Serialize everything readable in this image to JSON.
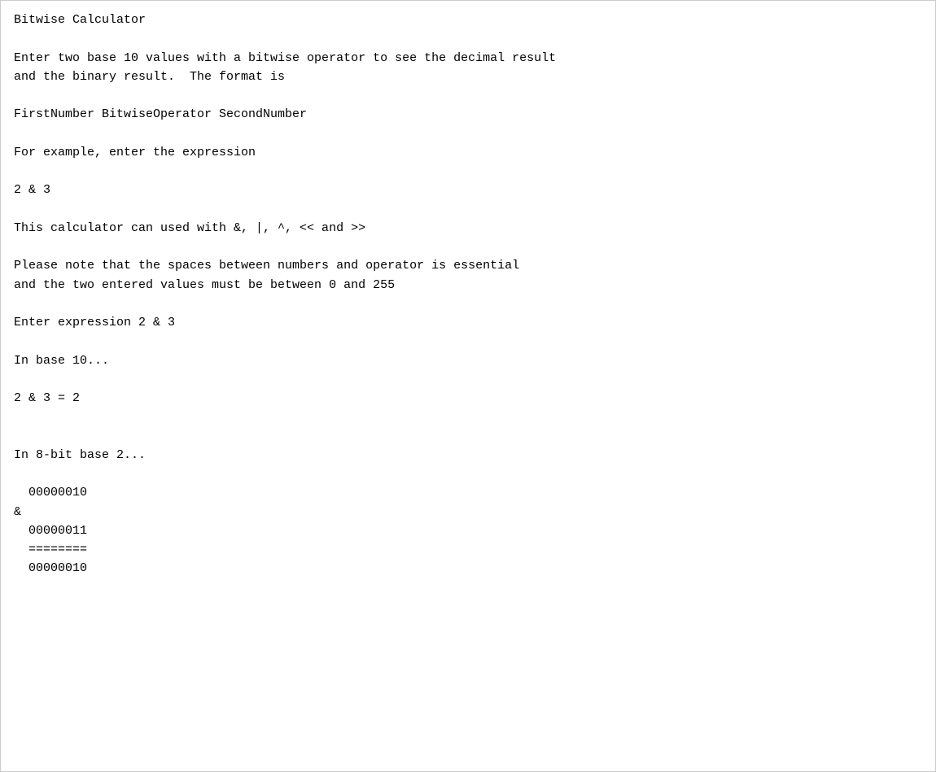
{
  "title": "Bitwise Calculator",
  "lines": [
    {
      "id": "title",
      "text": "Bitwise Calculator"
    },
    {
      "id": "blank1",
      "text": ""
    },
    {
      "id": "intro1",
      "text": "Enter two base 10 values with a bitwise operator to see the decimal result"
    },
    {
      "id": "intro2",
      "text": "and the binary result.  The format is"
    },
    {
      "id": "blank2",
      "text": ""
    },
    {
      "id": "format",
      "text": "FirstNumber BitwiseOperator SecondNumber"
    },
    {
      "id": "blank3",
      "text": ""
    },
    {
      "id": "example_label",
      "text": "For example, enter the expression"
    },
    {
      "id": "blank4",
      "text": ""
    },
    {
      "id": "example_expr",
      "text": "2 & 3"
    },
    {
      "id": "blank5",
      "text": ""
    },
    {
      "id": "operators",
      "text": "This calculator can used with &, |, ^, << and >>"
    },
    {
      "id": "blank6",
      "text": ""
    },
    {
      "id": "note1",
      "text": "Please note that the spaces between numbers and operator is essential"
    },
    {
      "id": "note2",
      "text": "and the two entered values must be between 0 and 255"
    },
    {
      "id": "blank7",
      "text": ""
    },
    {
      "id": "input_line",
      "text": "Enter expression 2 & 3"
    },
    {
      "id": "blank8",
      "text": ""
    },
    {
      "id": "base10_label",
      "text": "In base 10..."
    },
    {
      "id": "blank9",
      "text": ""
    },
    {
      "id": "base10_result",
      "text": "2 & 3 = 2"
    },
    {
      "id": "blank10",
      "text": ""
    },
    {
      "id": "blank11",
      "text": ""
    },
    {
      "id": "base2_label",
      "text": "In 8-bit base 2..."
    },
    {
      "id": "blank12",
      "text": ""
    },
    {
      "id": "binary_num1",
      "text": "  00000010"
    },
    {
      "id": "binary_op",
      "text": "&"
    },
    {
      "id": "binary_num2",
      "text": "  00000011"
    },
    {
      "id": "binary_sep",
      "text": "  ========"
    },
    {
      "id": "binary_result",
      "text": "  00000010"
    }
  ]
}
